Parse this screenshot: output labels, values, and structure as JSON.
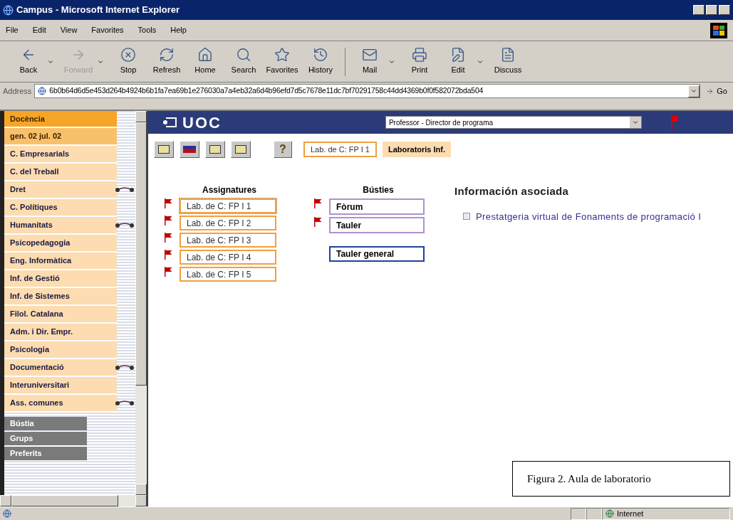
{
  "window": {
    "title": "Campus - Microsoft Internet Explorer"
  },
  "menu": [
    "File",
    "Edit",
    "View",
    "Favorites",
    "Tools",
    "Help"
  ],
  "toolbar": [
    {
      "label": "Back",
      "disabled": false,
      "dropdown": true
    },
    {
      "label": "Forward",
      "disabled": true,
      "dropdown": true
    },
    {
      "label": "Stop",
      "disabled": false,
      "dropdown": false
    },
    {
      "label": "Refresh",
      "disabled": false,
      "dropdown": false
    },
    {
      "label": "Home",
      "disabled": false,
      "dropdown": false
    },
    {
      "label": "Search",
      "disabled": false,
      "dropdown": false
    },
    {
      "label": "Favorites",
      "disabled": false,
      "dropdown": false
    },
    {
      "label": "History",
      "disabled": false,
      "dropdown": false
    },
    {
      "label": "Mail",
      "disabled": false,
      "dropdown": true
    },
    {
      "label": "Print",
      "disabled": false,
      "dropdown": false
    },
    {
      "label": "Edit",
      "disabled": false,
      "dropdown": true
    },
    {
      "label": "Discuss",
      "disabled": false,
      "dropdown": false
    }
  ],
  "address": {
    "label": "Address",
    "value": "6b0b64d6d5e453d264b4924b6b1fa7ea69b1e276030a7a4eb32a6d4b96efd7d5c7678e11dc7bf70291758c44dd4369b0f0f582072bda504",
    "go": "Go"
  },
  "sidebar": {
    "title": "Docència",
    "period": "gen. 02 jul. 02",
    "items": [
      {
        "label": "C. Empresarials",
        "ring": false
      },
      {
        "label": "C. del Treball",
        "ring": false
      },
      {
        "label": "Dret",
        "ring": true
      },
      {
        "label": "C. Polítiques",
        "ring": false
      },
      {
        "label": "Humanitats",
        "ring": true
      },
      {
        "label": "Psicopedagogia",
        "ring": false
      },
      {
        "label": "Eng. Informàtica",
        "ring": false
      },
      {
        "label": "Inf. de Gestió",
        "ring": false
      },
      {
        "label": "Inf. de Sistemes",
        "ring": false
      },
      {
        "label": "Filol. Catalana",
        "ring": false
      },
      {
        "label": "Adm. i Dir. Empr.",
        "ring": false
      },
      {
        "label": "Psicologia",
        "ring": false
      },
      {
        "label": "Documentació",
        "ring": true
      },
      {
        "label": "Interuniversitari",
        "ring": false
      },
      {
        "label": "Ass. comunes",
        "ring": true
      }
    ],
    "tabs": [
      "Bústia",
      "Grups",
      "Preferits"
    ]
  },
  "header": {
    "logo": "UOC",
    "role": "Professor - Director de programa"
  },
  "help": "?",
  "breadcrumb": {
    "subject": "Lab. de C: FP I 1",
    "tag": "Laboratoris Inf."
  },
  "assignatures": {
    "title": "Assignatures",
    "items": [
      {
        "label": "Lab. de C: FP I 1",
        "selected": true
      },
      {
        "label": "Lab. de C: FP I 2",
        "selected": false
      },
      {
        "label": "Lab. de C: FP I 3",
        "selected": false
      },
      {
        "label": "Lab. de C: FP I 4",
        "selected": false
      },
      {
        "label": "Lab. de C: FP I 5",
        "selected": false
      }
    ]
  },
  "busties": {
    "title": "Bústies",
    "items": [
      "Fòrum",
      "Tauler"
    ],
    "general": "Tauler general"
  },
  "info": {
    "title": "Información asociada",
    "link": "Prestatgeria virtual de Fonaments de programació I"
  },
  "caption": "Figura 2. Aula de laboratorio",
  "status_bar": {
    "zone": "Internet"
  }
}
